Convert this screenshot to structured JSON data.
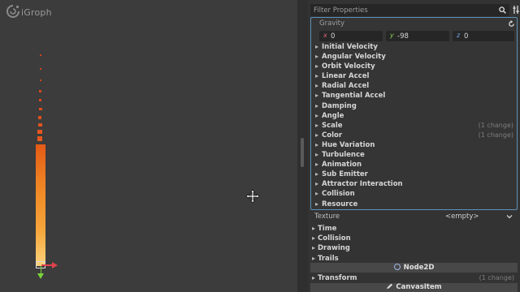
{
  "app": {
    "logo_text": "iGroph"
  },
  "viewport": {
    "move_cursor_icon": "move-cursor-icon",
    "particle_color_top": "#e45a16",
    "particle_color_bottom": "#fbd27a",
    "gizmo_x_color": "#e0424b",
    "gizmo_y_color": "#7bd33a"
  },
  "inspector": {
    "filter": {
      "placeholder": "Filter Properties",
      "value": ""
    },
    "gravity": {
      "label": "Gravity",
      "x_axis": "x",
      "x": "0",
      "y_axis": "y",
      "y": "-98",
      "z_axis": "z",
      "z": "0"
    },
    "process_material_groups": [
      {
        "label": "Initial Velocity",
        "note": ""
      },
      {
        "label": "Angular Velocity",
        "note": ""
      },
      {
        "label": "Orbit Velocity",
        "note": ""
      },
      {
        "label": "Linear Accel",
        "note": ""
      },
      {
        "label": "Radial Accel",
        "note": ""
      },
      {
        "label": "Tangential Accel",
        "note": ""
      },
      {
        "label": "Damping",
        "note": ""
      },
      {
        "label": "Angle",
        "note": ""
      },
      {
        "label": "Scale",
        "note": "(1 change)"
      },
      {
        "label": "Color",
        "note": "(1 change)"
      },
      {
        "label": "Hue Variation",
        "note": ""
      },
      {
        "label": "Turbulence",
        "note": ""
      },
      {
        "label": "Animation",
        "note": ""
      },
      {
        "label": "Sub Emitter",
        "note": ""
      },
      {
        "label": "Attractor Interaction",
        "note": ""
      },
      {
        "label": "Collision",
        "note": ""
      },
      {
        "label": "Resource",
        "note": ""
      }
    ],
    "texture": {
      "label": "Texture",
      "value": "<empty>"
    },
    "sections": [
      {
        "label": "Time"
      },
      {
        "label": "Collision"
      },
      {
        "label": "Drawing"
      },
      {
        "label": "Trails"
      }
    ],
    "node2d": {
      "label": "Node2D",
      "transform_label": "Transform",
      "transform_note": "(1 change)"
    },
    "canvas_item": {
      "label": "CanvasItem"
    },
    "accent_color": "#5b91b7"
  }
}
